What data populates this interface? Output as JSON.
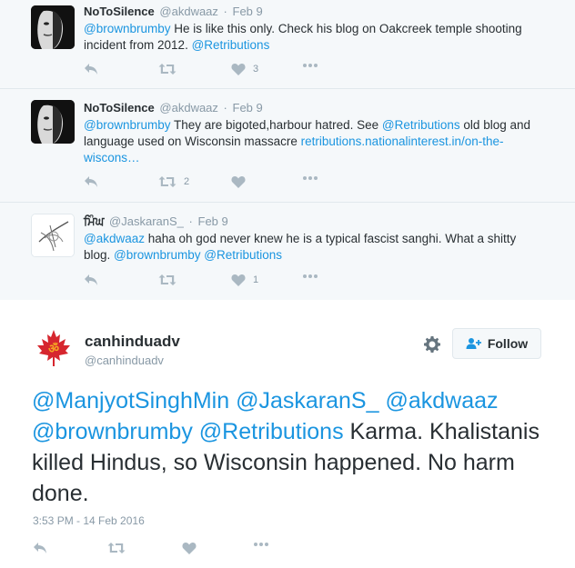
{
  "replies": [
    {
      "fullname": "NoToSilence",
      "username": "@akdwaaz",
      "sep": "·",
      "time": "Feb 9",
      "text_parts": [
        {
          "text": "@brownbrumby",
          "link": true
        },
        {
          "text": " He is like this only. Check his blog on Oakcreek temple shooting incident from 2012. ",
          "link": false
        },
        {
          "text": "@Retributions",
          "link": true
        }
      ],
      "retweets": "",
      "likes": "3"
    },
    {
      "fullname": "NoToSilence",
      "username": "@akdwaaz",
      "sep": "·",
      "time": "Feb 9",
      "text_parts": [
        {
          "text": "@brownbrumby",
          "link": true
        },
        {
          "text": " They are bigoted,harbour hatred. See ",
          "link": false
        },
        {
          "text": "@Retributions",
          "link": true
        },
        {
          "text": " old blog and language used on Wisconsin massacre ",
          "link": false
        },
        {
          "text": "retributions.nationalinterest.in/on-the-wiscons…",
          "link": true
        }
      ],
      "retweets": "2",
      "likes": ""
    },
    {
      "fullname": "ਮਿੰਘ",
      "username": "@JaskaranS_",
      "sep": "·",
      "time": "Feb 9",
      "text_parts": [
        {
          "text": "@akdwaaz",
          "link": true
        },
        {
          "text": " haha oh god never knew he is a typical fascist sanghi. What a shitty blog. ",
          "link": false
        },
        {
          "text": "@brownbrumby",
          "link": true
        },
        {
          "text": " ",
          "link": false
        },
        {
          "text": "@Retributions",
          "link": true
        }
      ],
      "retweets": "",
      "likes": "1"
    }
  ],
  "main": {
    "fullname": "canhinduadv",
    "username": "@canhinduadv",
    "follow_label": "Follow",
    "text_parts": [
      {
        "text": "@ManjyotSinghMin",
        "link": true
      },
      {
        "text": " ",
        "link": false
      },
      {
        "text": "@JaskaranS_",
        "link": true
      },
      {
        "text": " ",
        "link": false
      },
      {
        "text": "@akdwaaz",
        "link": true
      },
      {
        "text": " ",
        "link": false
      },
      {
        "text": "@brownbrumby",
        "link": true
      },
      {
        "text": " ",
        "link": false
      },
      {
        "text": "@Retributions",
        "link": true
      },
      {
        "text": " Karma. Khalistanis killed Hindus, so Wisconsin happened. No harm done.",
        "link": false
      }
    ],
    "timestamp": "3:53 PM - 14 Feb 2016"
  },
  "colors": {
    "link": "#1b95e0",
    "reply_bg": "#f5f8fa",
    "icon": "#aab8c2",
    "maple_red": "#d6262e"
  },
  "icons": [
    "reply-icon",
    "retweet-icon",
    "like-icon",
    "more-icon",
    "gear-icon",
    "follow-user-icon"
  ]
}
